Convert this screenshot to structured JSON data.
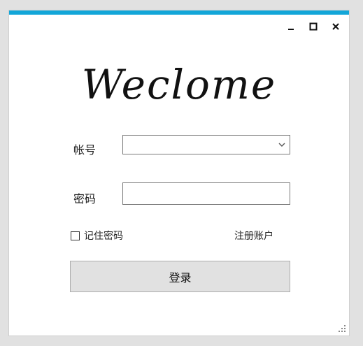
{
  "window": {
    "accent_color": "#13a6d8",
    "controls": {
      "minimize_icon": "minimize-icon",
      "maximize_icon": "maximize-icon",
      "close_icon": "close-icon"
    }
  },
  "header": {
    "welcome_text": "Weclome"
  },
  "form": {
    "account_label": "帐号",
    "account_value": "",
    "password_label": "密码",
    "password_value": "",
    "remember_label": "记住密码",
    "remember_checked": false,
    "register_link": "注册账户",
    "login_button": "登录"
  }
}
